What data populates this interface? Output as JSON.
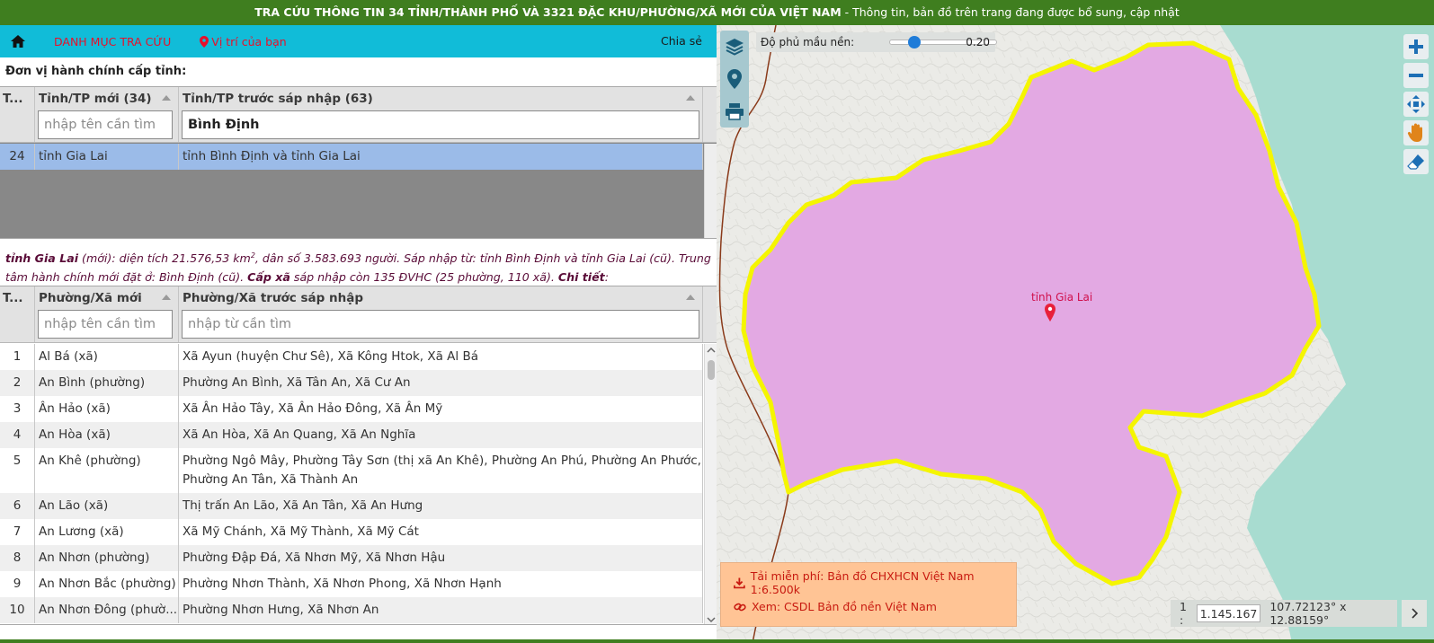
{
  "banner": {
    "title": "TRA CỨU THÔNG TIN 34 TỈNH/THÀNH PHỐ VÀ 3321 ĐẶC KHU/PHƯỜNG/XÃ MỚI CỦA VIỆT NAM",
    "subtitle": " - Thông tin, bản đồ trên trang đang được bổ sung, cập nhật"
  },
  "nav": {
    "catalog_label": "DANH MỤC TRA CỨU",
    "location_label": "Vị trí của bạn",
    "share_label": "Chia sẻ"
  },
  "province_section": {
    "label": "Đơn vị hành chính cấp tỉnh:",
    "col_num": "T...",
    "col_new": "Tỉnh/TP mới (34)",
    "col_old": "Tỉnh/TP trước sáp nhập (63)",
    "new_placeholder": "nhập tên cần tìm",
    "old_filter_value": "Bình Định",
    "rows": [
      {
        "num": "24",
        "new": "tỉnh Gia Lai",
        "old": "tỉnh Bình Định và tỉnh Gia Lai"
      }
    ]
  },
  "info": {
    "name": "tỉnh Gia Lai",
    "text1": " (mới): diện tích 21.576,53 km",
    "sup": "2",
    "text2": ", dân số 3.583.693 người. Sáp nhập từ: tỉnh Bình Định và tỉnh Gia Lai (cũ). Trung tâm hành chính mới đặt ở: Bình Định (cũ). ",
    "cap_xa": "Cấp xã",
    "text3": " sáp nhập còn 135 ĐVHC (25 phường, 110 xã). ",
    "chi_tiet": "Chi tiết",
    "colon": ":"
  },
  "ward_section": {
    "col_num": "T...",
    "col_new": "Phường/Xã mới",
    "col_old": "Phường/Xã trước sáp nhập",
    "new_placeholder": "nhập tên cần tìm",
    "old_placeholder": "nhập từ cần tìm",
    "rows": [
      {
        "num": "1",
        "new": "Al Bá (xã)",
        "old": "Xã Ayun (huyện Chư Sê), Xã Kông Htok, Xã Al Bá"
      },
      {
        "num": "2",
        "new": "An Bình (phường)",
        "old": "Phường An Bình, Xã Tân An, Xã Cư An"
      },
      {
        "num": "3",
        "new": "Ân Hảo (xã)",
        "old": "Xã Ân Hảo Tây, Xã Ân Hảo Đông, Xã Ân Mỹ"
      },
      {
        "num": "4",
        "new": "An Hòa (xã)",
        "old": "Xã An Hòa, Xã An Quang, Xã An Nghĩa"
      },
      {
        "num": "5",
        "new": "An Khê (phường)",
        "old": "Phường Ngô Mây, Phường Tây Sơn (thị xã An Khê), Phường An Phú, Phường An Phước,",
        "old2": "Phường An Tân, Xã Thành An"
      },
      {
        "num": "6",
        "new": "An Lão (xã)",
        "old": "Thị trấn An Lão, Xã An Tân, Xã An Hưng"
      },
      {
        "num": "7",
        "new": "An Lương (xã)",
        "old": "Xã Mỹ Chánh, Xã Mỹ Thành, Xã Mỹ Cát"
      },
      {
        "num": "8",
        "new": "An Nhơn (phường)",
        "old": "Phường Đập Đá, Xã Nhơn Mỹ, Xã Nhơn Hậu"
      },
      {
        "num": "9",
        "new": "An Nhơn Bắc (phường)",
        "old": "Phường Nhơn Thành, Xã Nhơn Phong, Xã Nhơn Hạnh"
      },
      {
        "num": "10",
        "new": "An Nhơn Đông (phườ...",
        "old": "Phường Nhơn Hưng, Xã Nhơn An"
      }
    ]
  },
  "map": {
    "opacity_label": "Độ phủ mầu nền:",
    "opacity_value": "0.20",
    "opacity_fraction": 0.2,
    "place_label": "tỉnh Gia Lai",
    "download_label": "Tải miễn phí: Bản đồ CHXHCN Việt Nam 1:6.500k",
    "view_label": "Xem: CSDL Bản đồ nền Việt Nam",
    "scale_prefix": "1 :",
    "scale_value": "1.145.167",
    "coords": "107.72123° x 12.88159°",
    "colors": {
      "province_fill": "#e3a9e3",
      "province_border": "#f5f500",
      "sea": "#a8dcd0",
      "land": "#ecece8",
      "boundary": "#8a3a1a",
      "marker": "#e8203a"
    },
    "icons": [
      "layers-icon",
      "map-marker-icon",
      "print-icon",
      "zoom-in-icon",
      "zoom-out-icon",
      "zoom-extent-icon",
      "pan-hand-icon",
      "eraser-icon"
    ]
  }
}
